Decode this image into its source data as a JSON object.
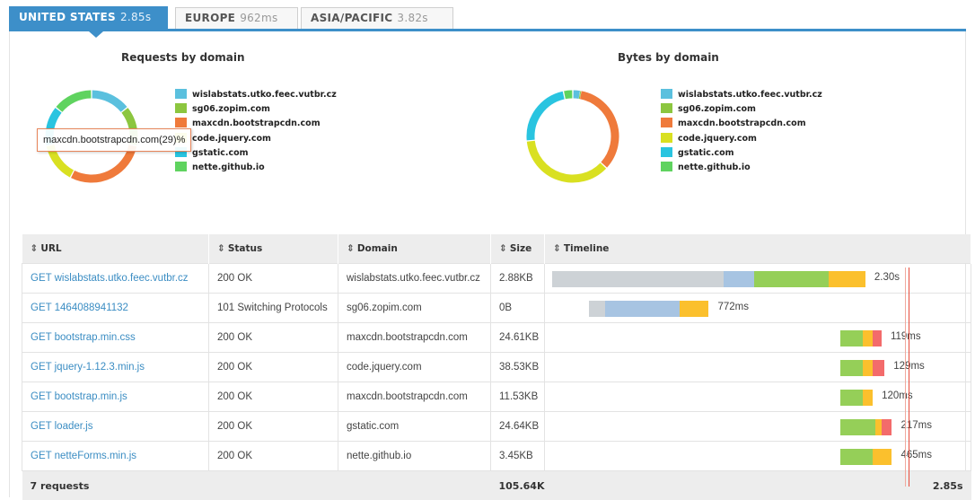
{
  "tabs": [
    {
      "region": "UNITED STATES",
      "time": "2.85s",
      "active": true
    },
    {
      "region": "EUROPE",
      "time": "962ms",
      "active": false
    },
    {
      "region": "ASIA/PACIFIC",
      "time": "3.82s",
      "active": false
    }
  ],
  "colors": {
    "accent": "#3d8fc9",
    "wislabstats": "#5bc0de",
    "sg06": "#8cc63f",
    "maxcdn": "#ef7a3b",
    "jquery": "#d9e021",
    "gstatic": "#29c4e0",
    "nette": "#5fd35f",
    "timeline_dns": "#cdd2d6",
    "timeline_connect": "#a7c4e2",
    "timeline_wait": "#95cf58",
    "timeline_receive": "#fbc02d",
    "timeline_extra": "#f36b6b",
    "marker_load": "#e74c3c",
    "marker_dom": "#f0a99e"
  },
  "charts": {
    "requests": {
      "title": "Requests by domain",
      "legend": [
        {
          "label": "wislabstats.utko.feec.vutbr.cz",
          "color": "#5bc0de"
        },
        {
          "label": "sg06.zopim.com",
          "color": "#8cc63f"
        },
        {
          "label": "maxcdn.bootstrapcdn.com",
          "color": "#ef7a3b"
        },
        {
          "label": "code.jquery.com",
          "color": "#d9e021"
        },
        {
          "label": "gstatic.com",
          "color": "#29c4e0"
        },
        {
          "label": "nette.github.io",
          "color": "#5fd35f"
        }
      ],
      "tooltip": "maxcdn.bootstrapcdn.com(29)%"
    },
    "bytes": {
      "title": "Bytes by domain",
      "legend": [
        {
          "label": "wislabstats.utko.feec.vutbr.cz",
          "color": "#5bc0de"
        },
        {
          "label": "sg06.zopim.com",
          "color": "#8cc63f"
        },
        {
          "label": "maxcdn.bootstrapcdn.com",
          "color": "#ef7a3b"
        },
        {
          "label": "code.jquery.com",
          "color": "#d9e021"
        },
        {
          "label": "gstatic.com",
          "color": "#29c4e0"
        },
        {
          "label": "nette.github.io",
          "color": "#5fd35f"
        }
      ]
    }
  },
  "chart_data": [
    {
      "type": "pie",
      "title": "Requests by domain",
      "categories": [
        "wislabstats.utko.feec.vutbr.cz",
        "sg06.zopim.com",
        "maxcdn.bootstrapcdn.com",
        "code.jquery.com",
        "gstatic.com",
        "nette.github.io"
      ],
      "values": [
        14,
        14,
        29,
        14,
        14,
        14
      ]
    },
    {
      "type": "pie",
      "title": "Bytes by domain",
      "categories": [
        "wislabstats.utko.feec.vutbr.cz",
        "sg06.zopim.com",
        "maxcdn.bootstrapcdn.com",
        "code.jquery.com",
        "gstatic.com",
        "nette.github.io"
      ],
      "values": [
        2.7,
        0.1,
        34.2,
        36.5,
        23.3,
        3.3
      ]
    }
  ],
  "table": {
    "headers": {
      "url": "URL",
      "status": "Status",
      "domain": "Domain",
      "size": "Size",
      "timeline": "Timeline"
    },
    "rows": [
      {
        "url": "GET wislabstats.utko.feec.vutbr.cz",
        "status": "200 OK",
        "domain": "wislabstats.utko.feec.vutbr.cz",
        "size": "2.88KB",
        "duration": "2.30s",
        "start_s": 0.0,
        "phases_s": [
          1.16,
          0.21,
          0.5,
          0.25,
          0
        ]
      },
      {
        "url": "GET 1464088941132",
        "status": "101 Switching Protocols",
        "domain": "sg06.zopim.com",
        "size": "0B",
        "duration": "772ms",
        "start_s": 0.25,
        "phases_s": [
          0.11,
          0.5,
          0.0,
          0.2,
          0
        ]
      },
      {
        "url": "GET bootstrap.min.css",
        "status": "200 OK",
        "domain": "maxcdn.bootstrapcdn.com",
        "size": "24.61KB",
        "duration": "119ms",
        "start_s": 1.95,
        "phases_s": [
          0,
          0,
          0.15,
          0.07,
          0.06
        ]
      },
      {
        "url": "GET jquery-1.12.3.min.js",
        "status": "200 OK",
        "domain": "code.jquery.com",
        "size": "38.53KB",
        "duration": "129ms",
        "start_s": 1.95,
        "phases_s": [
          0,
          0,
          0.15,
          0.07,
          0.08
        ]
      },
      {
        "url": "GET bootstrap.min.js",
        "status": "200 OK",
        "domain": "maxcdn.bootstrapcdn.com",
        "size": "11.53KB",
        "duration": "120ms",
        "start_s": 1.95,
        "phases_s": [
          0,
          0,
          0.15,
          0.07,
          0
        ]
      },
      {
        "url": "GET loader.js",
        "status": "200 OK",
        "domain": "gstatic.com",
        "size": "24.64KB",
        "duration": "217ms",
        "start_s": 1.95,
        "phases_s": [
          0,
          0,
          0.24,
          0.04,
          0.07
        ]
      },
      {
        "url": "GET netteForms.min.js",
        "status": "200 OK",
        "domain": "nette.github.io",
        "size": "3.45KB",
        "duration": "465ms",
        "start_s": 1.95,
        "phases_s": [
          0,
          0,
          0.22,
          0.13,
          0
        ]
      }
    ],
    "footer": {
      "requests": "7 requests",
      "size": "105.64KB",
      "total": "2.85s"
    },
    "total_s": 2.85,
    "dom_loaded_s": 2.36,
    "page_loaded_s": 2.38
  }
}
